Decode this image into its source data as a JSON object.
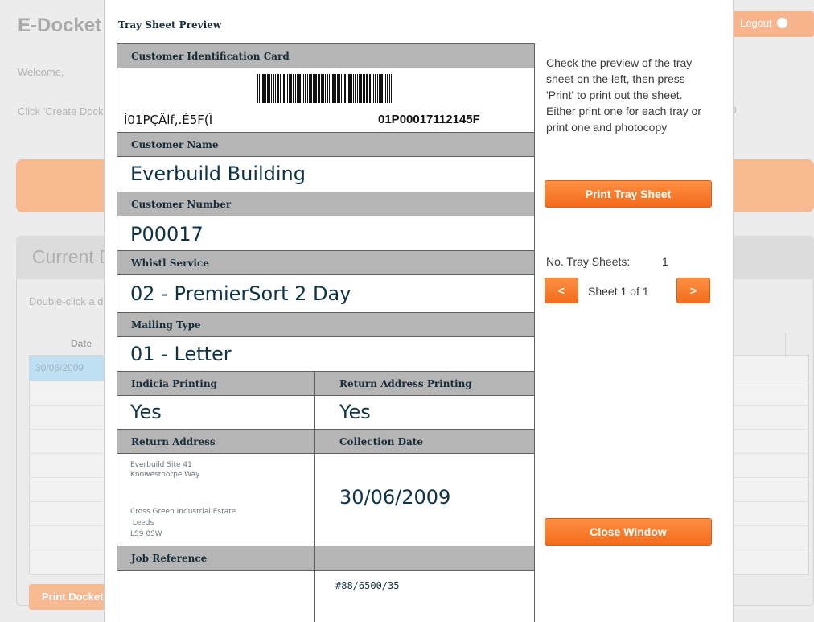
{
  "background": {
    "app_title": "E-Docket",
    "logout_label": "Logout",
    "welcome": "Welcome,",
    "instructions": "Click 'Create Docket' to create a new docket or double-click a docket to edit an outstanding docket",
    "instructions_right": "to",
    "panel_title": "Current Dockets",
    "panel_instructions": "Double-click a docket and press 'Print'",
    "grid_header": "Date",
    "grid_row_date": "30/06/2009",
    "print_docket_label": "Print Docket"
  },
  "modal": {
    "title": "Tray Sheet Preview",
    "help_text": "Check the preview of the tray sheet on the left, then press 'Print' to print out the sheet. Either print one for each tray or print one and photocopy",
    "print_button": "Print Tray Sheet",
    "count_label": "No. Tray Sheets:",
    "count_value": "1",
    "prev_label": "<",
    "next_label": ">",
    "pager_text": "Sheet 1 of 1",
    "close_button": "Close Window"
  },
  "sheet": {
    "customer_id_card": {
      "label": "Customer Identification Card",
      "barcode_text": "Ì01PÇÂlf,.È5F(Î",
      "barcode_value": "01P00017112145F"
    },
    "customer_name": {
      "label": "Customer Name",
      "value": "Everbuild Building"
    },
    "customer_number": {
      "label": "Customer Number",
      "value": "P00017"
    },
    "service": {
      "label": "Whistl Service",
      "value": "02 - PremierSort 2 Day"
    },
    "mailing_type": {
      "label": "Mailing Type",
      "value": "01 - Letter"
    },
    "indicia": {
      "label": "Indicia Printing",
      "value": "Yes"
    },
    "return_printing": {
      "label": "Return Address Printing",
      "value": "Yes"
    },
    "return_address": {
      "label": "Return Address",
      "line1": "Everbuild Site 41",
      "line2": "Knowesthorpe Way",
      "line3": "Cross Green Industrial Estate",
      "line4": " Leeds",
      "line5": "LS9 0SW"
    },
    "collection_date": {
      "label": "Collection Date",
      "value": "30/06/2009"
    },
    "job_reference": {
      "label": "Job Reference",
      "value": "#88/6500/35"
    }
  }
}
